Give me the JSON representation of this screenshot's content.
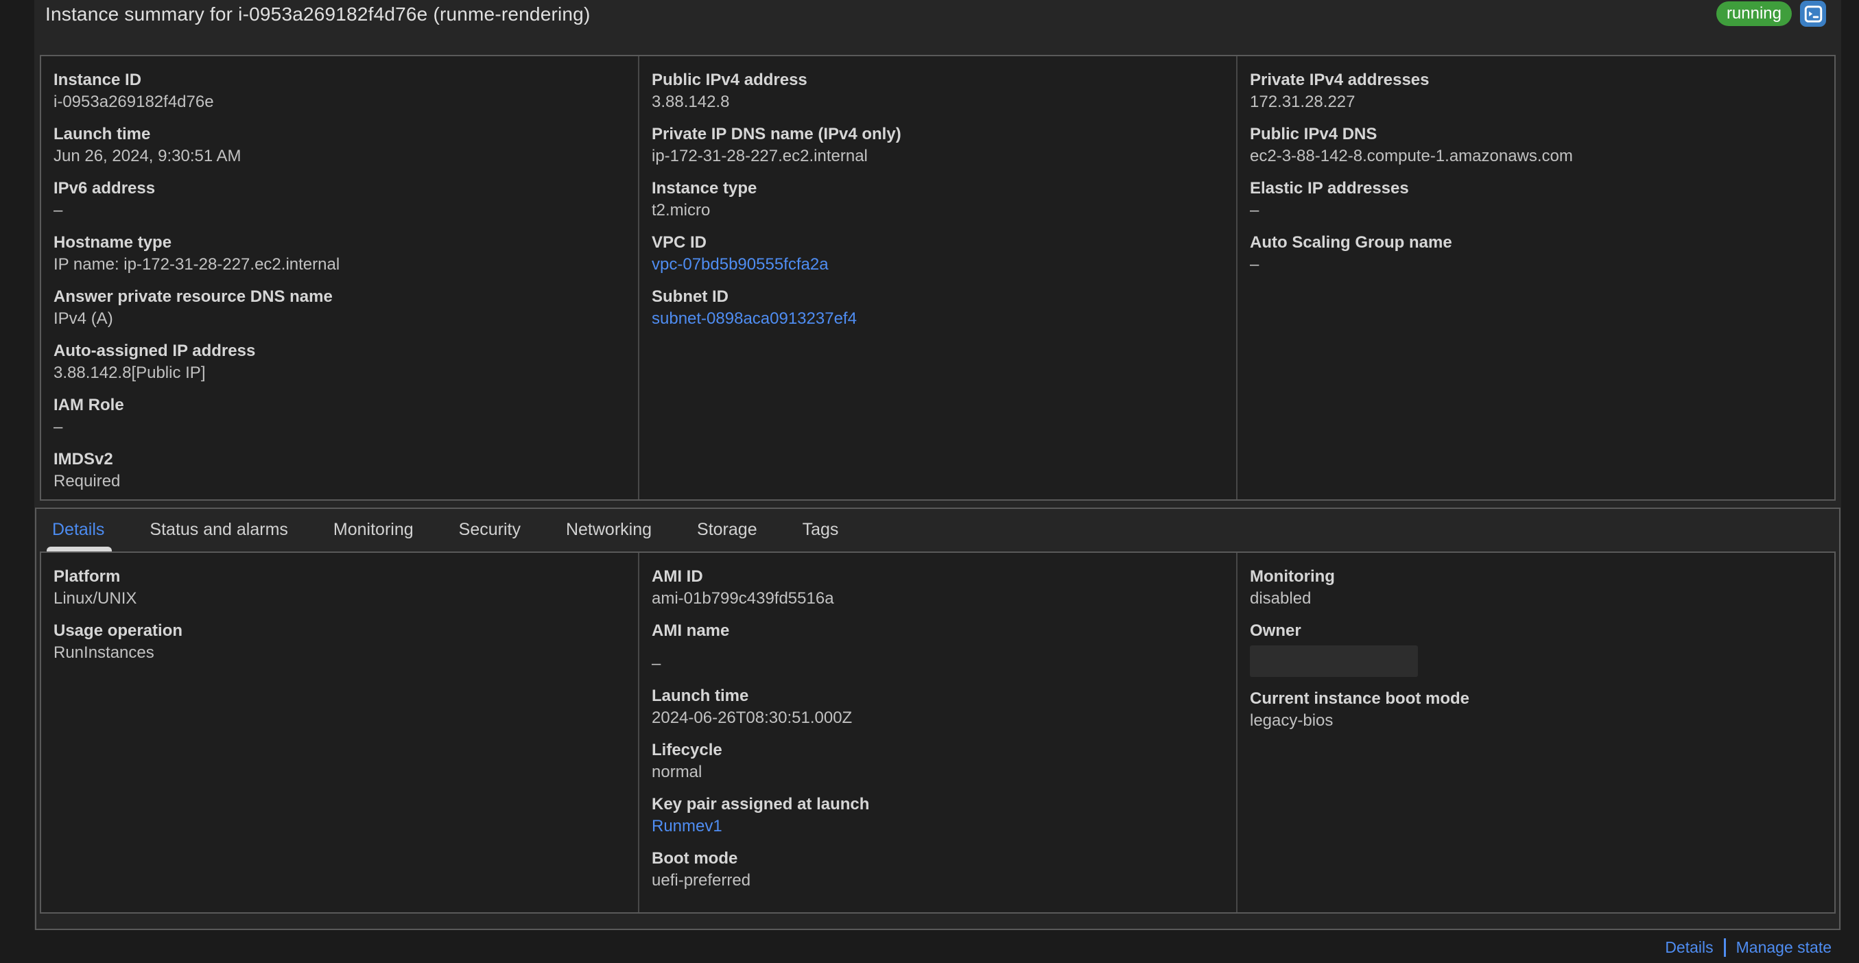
{
  "header": {
    "title": "Instance summary for i-0953a269182f4d76e (runme-rendering)",
    "state_badge": {
      "label": "running"
    },
    "connect_button": {
      "icon": "terminal-icon"
    }
  },
  "summary_panel": {
    "columns": [
      {
        "fields": [
          {
            "label": "Instance ID",
            "value": "i-0953a269182f4d76e"
          },
          {
            "label": "Launch time",
            "value": "Jun 26, 2024, 9:30:51 AM"
          },
          {
            "label": "IPv6 address",
            "value": "–"
          },
          {
            "label": "Hostname type",
            "value": "IP name: ip-172-31-28-227.ec2.internal"
          },
          {
            "label": "Answer private resource DNS name",
            "value": "IPv4 (A)"
          },
          {
            "label": "Auto-assigned IP address",
            "value": "3.88.142.8[Public IP]"
          },
          {
            "label": "IAM Role",
            "value": "–"
          },
          {
            "label": "IMDSv2",
            "value": "Required"
          }
        ]
      },
      {
        "fields": [
          {
            "label": "Public IPv4 address",
            "value": "3.88.142.8"
          },
          {
            "label": "Private IP DNS name (IPv4 only)",
            "value": "ip-172-31-28-227.ec2.internal"
          },
          {
            "label": "Instance type",
            "value": "t2.micro"
          },
          {
            "label": "VPC ID",
            "value": "vpc-07bd5b90555fcfa2a",
            "link": true
          },
          {
            "label": "Subnet ID",
            "value": "subnet-0898aca0913237ef4",
            "link": true
          }
        ]
      },
      {
        "fields": [
          {
            "label": "Private IPv4 addresses",
            "value": "172.31.28.227"
          },
          {
            "label": "Public IPv4 DNS",
            "value": "ec2-3-88-142-8.compute-1.amazonaws.com"
          },
          {
            "label": "Elastic IP addresses",
            "value": "–"
          },
          {
            "label": "Auto Scaling Group name",
            "value": "–"
          }
        ]
      }
    ]
  },
  "tabs": {
    "items": [
      {
        "label": "Details",
        "active": true
      },
      {
        "label": "Status and alarms"
      },
      {
        "label": "Monitoring"
      },
      {
        "label": "Security"
      },
      {
        "label": "Networking"
      },
      {
        "label": "Storage"
      },
      {
        "label": "Tags"
      }
    ]
  },
  "details_panel": {
    "columns": [
      {
        "fields": [
          {
            "label": "Platform",
            "value": "Linux/UNIX"
          },
          {
            "label": "Usage operation",
            "value": "RunInstances"
          }
        ]
      },
      {
        "fields": [
          {
            "label": "AMI ID",
            "value": "ami-01b799c439fd5516a"
          },
          {
            "label": "AMI name",
            "value": "–",
            "extra_gap": true
          },
          {
            "label": "Launch time",
            "value": "2024-06-26T08:30:51.000Z"
          },
          {
            "label": "Lifecycle",
            "value": "normal"
          },
          {
            "label": "Key pair assigned at launch",
            "value": "Runmev1",
            "link": true
          },
          {
            "label": "Boot mode",
            "value": "uefi-preferred"
          }
        ]
      },
      {
        "fields": [
          {
            "label": "Monitoring",
            "value": "disabled"
          },
          {
            "label": "Owner",
            "value": "",
            "redacted": true
          },
          {
            "label": "Current instance boot mode",
            "value": "legacy-bios"
          }
        ]
      }
    ]
  },
  "footer": {
    "links": [
      {
        "label": "Details"
      },
      {
        "label": "Manage state"
      }
    ]
  },
  "colors": {
    "link": "#4f8df2",
    "active_tab": "#4c8bf0",
    "badge_green": "#3f9e3c",
    "connect_blue": "#3b7fc4"
  }
}
